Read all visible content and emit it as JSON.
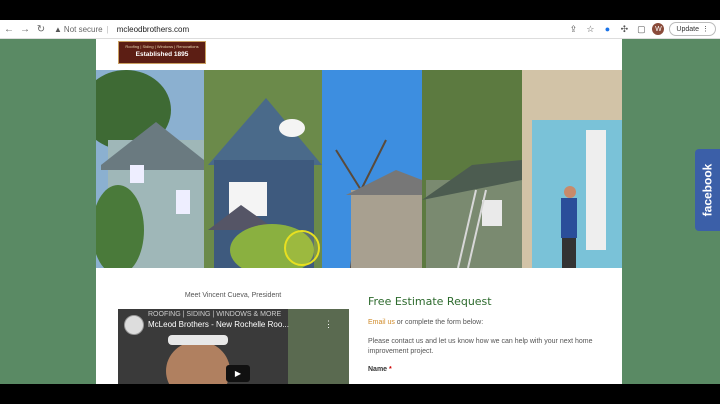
{
  "browser": {
    "url": "mcleodbrothers.com",
    "security_label": "Not secure",
    "update_label": "Update",
    "profile_initial": "W"
  },
  "logo": {
    "tagline": "Roofing | Siding | Windows | Renovations",
    "established": "Established 1895"
  },
  "about": {
    "meet_text": "Meet Vincent Cueva, President",
    "video_title": "McLeod Brothers - New Rochelle Roo...",
    "video_overlay": "ROOFING | SIDING | WINDOWS & MORE"
  },
  "estimate": {
    "title": "Free Estimate Request",
    "email_link": "Email us",
    "email_rest": " or complete the form below:",
    "contact_text": "Please contact us and let us know how we can help with your next home improvement project.",
    "name_label": "Name",
    "required_mark": "*"
  },
  "social": {
    "facebook_label": "facebook"
  },
  "colors": {
    "background_green": "#5a8a64",
    "title_green": "#2d6a2d",
    "link_orange": "#d08b2a",
    "facebook_blue": "#3b5fa8",
    "logo_maroon": "#5c1e14"
  }
}
